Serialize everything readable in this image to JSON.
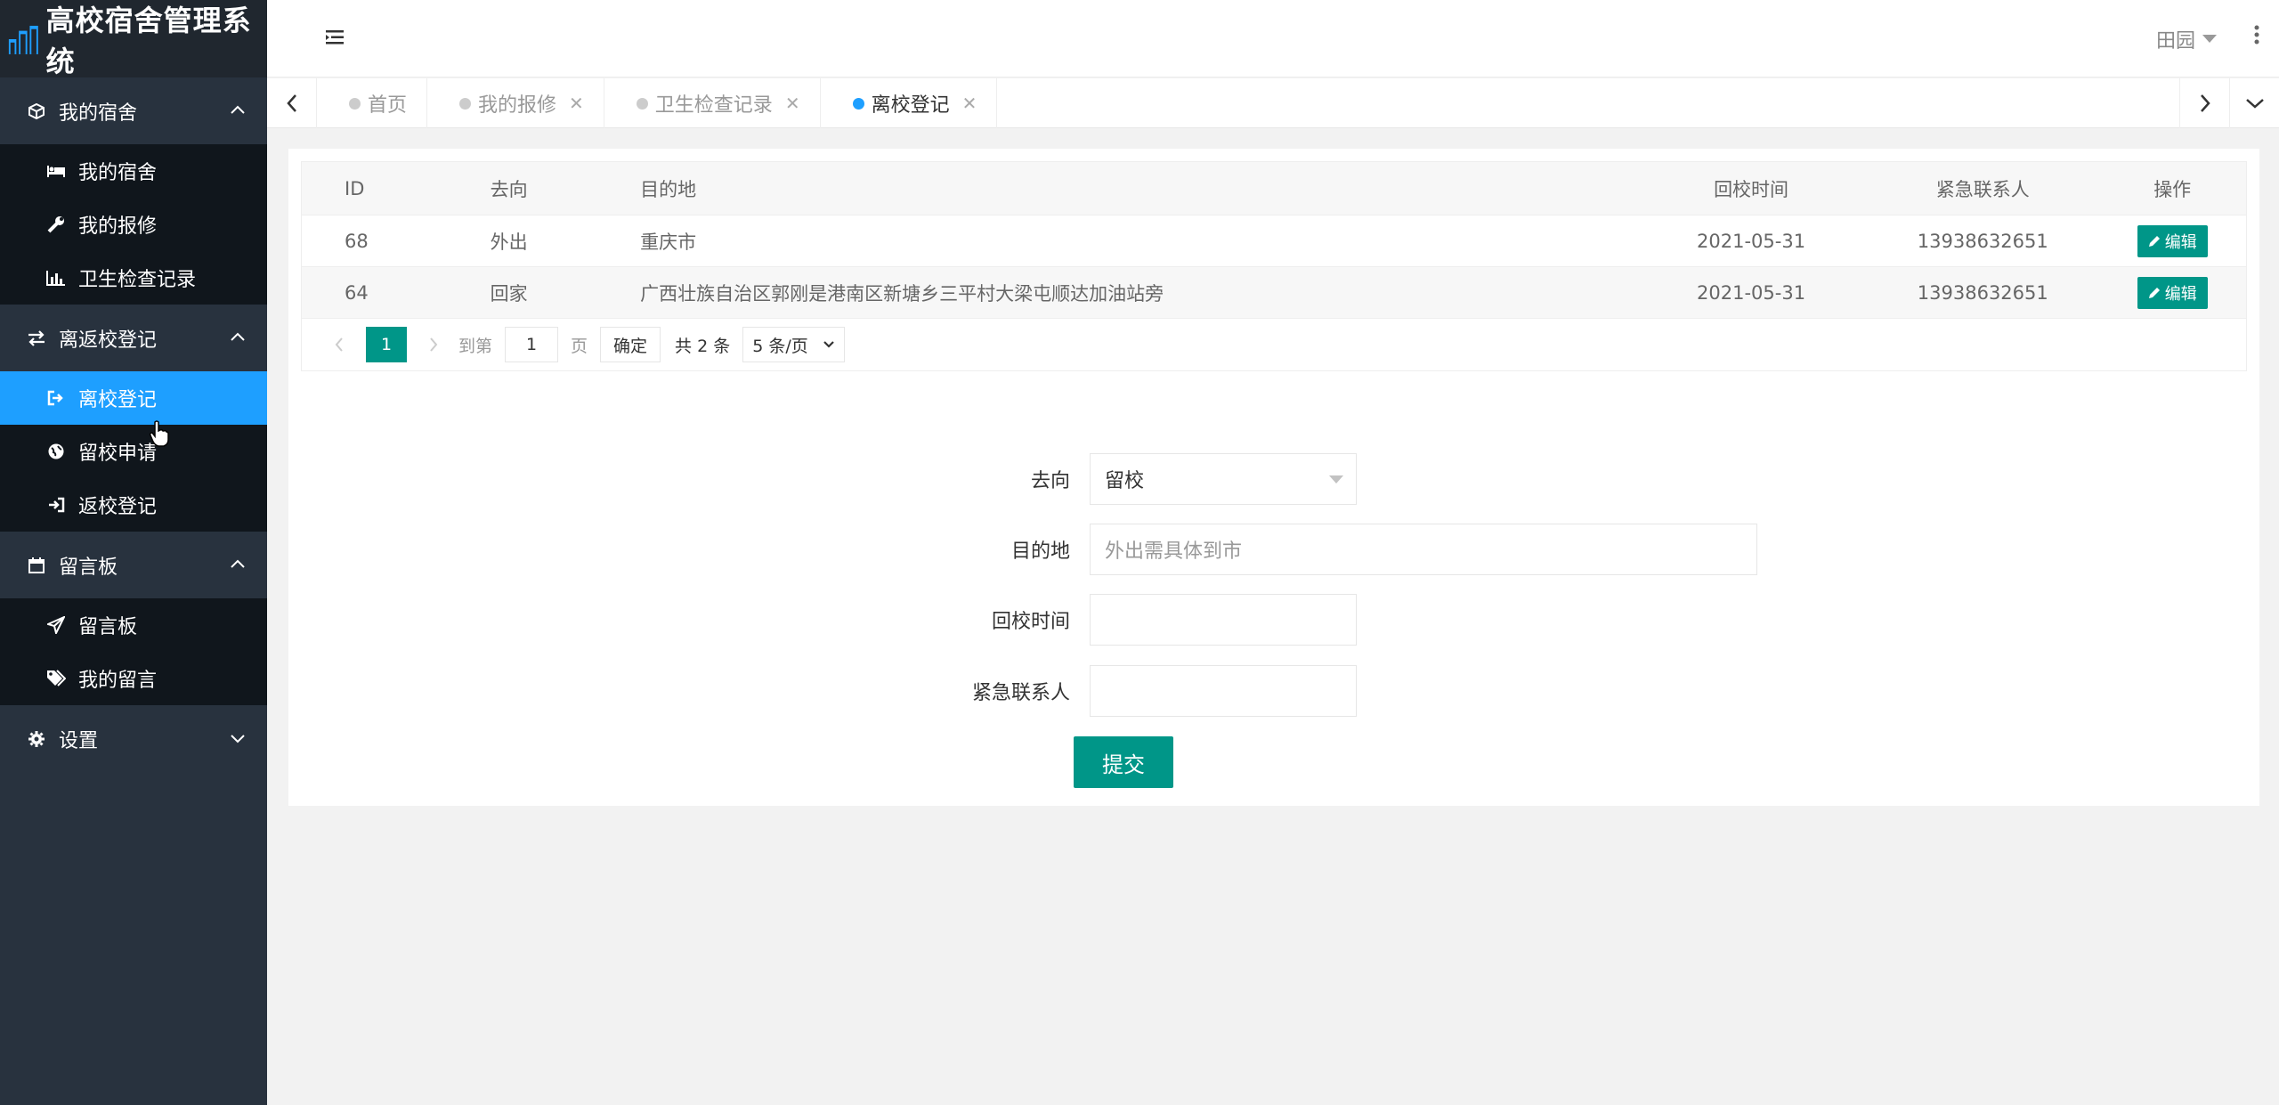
{
  "app": {
    "title": "高校宿舍管理系统"
  },
  "sidebar": {
    "groups": [
      {
        "label": "我的宿舍",
        "icon": "cube-icon",
        "expanded": true,
        "items": [
          {
            "label": "我的宿舍",
            "icon": "bed-icon"
          },
          {
            "label": "我的报修",
            "icon": "wrench-icon"
          },
          {
            "label": "卫生检查记录",
            "icon": "bar-chart-icon"
          }
        ]
      },
      {
        "label": "离返校登记",
        "icon": "exchange-icon",
        "expanded": true,
        "items": [
          {
            "label": "离校登记",
            "icon": "sign-out-icon",
            "active": true
          },
          {
            "label": "留校申请",
            "icon": "globe-icon"
          },
          {
            "label": "返校登记",
            "icon": "sign-in-icon"
          }
        ]
      },
      {
        "label": "留言板",
        "icon": "calendar-icon",
        "expanded": true,
        "items": [
          {
            "label": "留言板",
            "icon": "paper-plane-icon"
          },
          {
            "label": "我的留言",
            "icon": "tags-icon"
          }
        ]
      },
      {
        "label": "设置",
        "icon": "gear-icon",
        "expanded": false,
        "items": []
      }
    ]
  },
  "header": {
    "user": "田园"
  },
  "tabs": [
    {
      "label": "首页",
      "closable": false,
      "active": false
    },
    {
      "label": "我的报修",
      "closable": true,
      "active": false
    },
    {
      "label": "卫生检查记录",
      "closable": true,
      "active": false
    },
    {
      "label": "离校登记",
      "closable": true,
      "active": true
    }
  ],
  "table": {
    "columns": [
      "ID",
      "去向",
      "目的地",
      "回校时间",
      "紧急联系人",
      "操作"
    ],
    "rows": [
      {
        "id": "68",
        "direction": "外出",
        "destination": "重庆市",
        "return_date": "2021-05-31",
        "contact": "13938632651",
        "action": "编辑"
      },
      {
        "id": "64",
        "direction": "回家",
        "destination": "广西壮族自治区郭刚是港南区新塘乡三平村大梁屯顺达加油站旁",
        "return_date": "2021-05-31",
        "contact": "13938632651",
        "action": "编辑"
      }
    ],
    "pager": {
      "current_page": "1",
      "goto_label": "到第",
      "goto_value": "1",
      "page_label": "页",
      "confirm": "确定",
      "total": "共 2 条",
      "page_size": "5 条/页"
    }
  },
  "form": {
    "direction": {
      "label": "去向",
      "value": "留校"
    },
    "destination": {
      "label": "目的地",
      "placeholder": "外出需具体到市"
    },
    "return_time": {
      "label": "回校时间",
      "value": ""
    },
    "contact": {
      "label": "紧急联系人",
      "value": ""
    },
    "submit": "提交"
  },
  "colors": {
    "primary": "#009688",
    "active_menu": "#1e9fff",
    "sidebar_bg": "#28323e",
    "submenu_bg": "#10161c"
  }
}
